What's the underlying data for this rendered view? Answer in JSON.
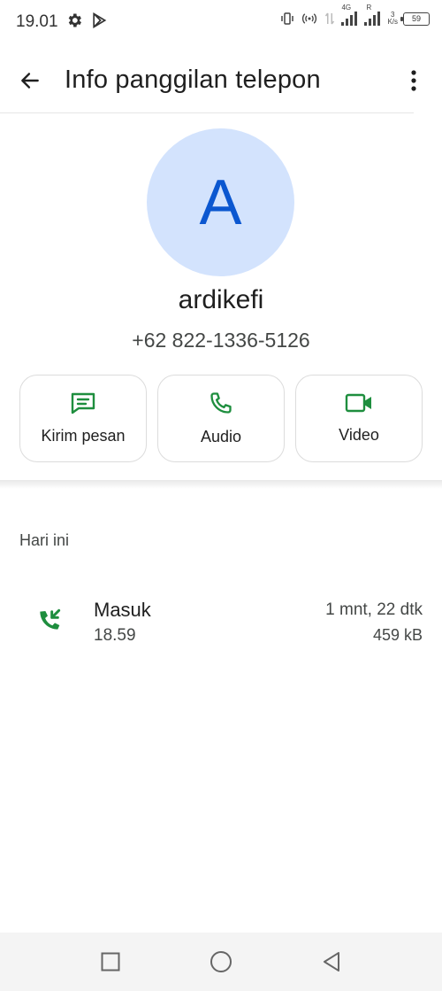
{
  "status_bar": {
    "time": "19.01",
    "net_label": "4G",
    "roaming_label": "R",
    "speed_value": "3",
    "speed_unit": "K/s",
    "battery": "59"
  },
  "app_bar": {
    "title": "Info panggilan telepon"
  },
  "contact": {
    "initial": "A",
    "name": "ardikefi",
    "phone": "+62 822-1336-5126"
  },
  "actions": [
    {
      "label": "Kirim pesan",
      "icon": "message-icon"
    },
    {
      "label": "Audio",
      "icon": "phone-icon"
    },
    {
      "label": "Video",
      "icon": "video-icon"
    }
  ],
  "history": {
    "section_title": "Hari ini",
    "entries": [
      {
        "type": "Masuk",
        "time": "18.59",
        "duration": "1 mnt, 22 dtk",
        "size": "459 kB",
        "icon": "incoming-call-icon"
      }
    ]
  },
  "colors": {
    "accent_green": "#1e8e3e",
    "avatar_bg": "#d3e3fd",
    "avatar_text": "#0b57d0"
  }
}
